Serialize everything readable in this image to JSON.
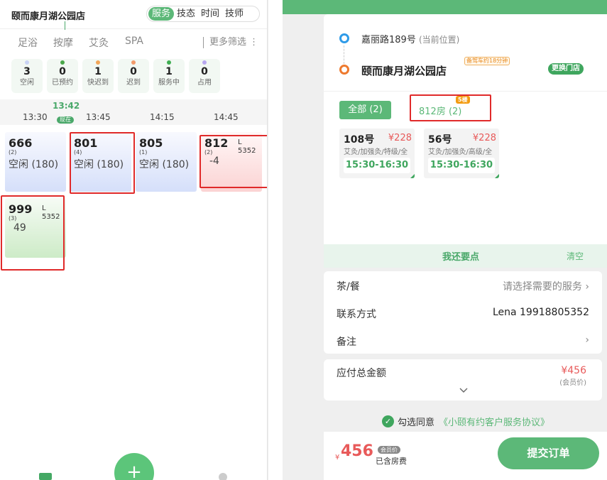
{
  "left": {
    "store_title": "颐而康月湖公园店",
    "segments": [
      "服务",
      "技态",
      "时间",
      "技师"
    ],
    "categories": [
      "足浴",
      "按摩",
      "艾灸",
      "SPA"
    ],
    "more_filter": "更多筛选 ⋮",
    "stats": [
      {
        "num": "3",
        "label": "空闲",
        "color": "#c9d3f5"
      },
      {
        "num": "0",
        "label": "已预约",
        "color": "#4aa84a"
      },
      {
        "num": "1",
        "label": "快迟到",
        "color": "#f2a65a"
      },
      {
        "num": "0",
        "label": "迟到",
        "color": "#f29a6a"
      },
      {
        "num": "1",
        "label": "服务中",
        "color": "#3fae52"
      },
      {
        "num": "0",
        "label": "占用",
        "color": "#b8a8f0"
      }
    ],
    "times": [
      "13:30",
      "13:45",
      "14:15",
      "14:45"
    ],
    "now_time": "13:42",
    "now_badge": "现在",
    "cards": [
      {
        "room": "666",
        "count": "(2)",
        "status": "空闲 (180)"
      },
      {
        "room": "801",
        "count": "(4)",
        "status": "空闲 (180)"
      },
      {
        "room": "805",
        "count": "(1)",
        "status": "空闲 (180)"
      },
      {
        "room": "812",
        "count": "(2)",
        "level": "L",
        "phone": "5352",
        "amount": "-4"
      },
      {
        "room": "999",
        "count": "(3)",
        "level": "L",
        "phone": "5352",
        "amount": "49"
      }
    ],
    "fab": "+"
  },
  "right": {
    "current_address": "嘉丽路189号",
    "current_address_note": "(当前位置)",
    "shop_name": "颐而康月湖公园店",
    "eta_tag": "备驾车约18分钟",
    "change_store": "更换门店",
    "all_button": "全部 (2)",
    "room_tag": "812房 (2)",
    "floor_badge": "5楼",
    "services": [
      {
        "room": "108号",
        "price": "¥228",
        "desc": "艾灸/加强灸/特级/全",
        "time": "15:30-16:30"
      },
      {
        "room": "56号",
        "price": "¥228",
        "desc": "艾灸/加强灸/高级/全",
        "time": "15:30-16:30"
      }
    ],
    "add_more": "我还要点",
    "clear": "清空",
    "tea_label": "茶/餐",
    "tea_value": "请选择需要的服务 ›",
    "contact_label": "联系方式",
    "contact_value": "Lena 19918805352",
    "note_label": "备注",
    "note_value": "›",
    "total_label": "应付总金额",
    "total_price": "¥456",
    "total_member": "(会员价)",
    "agree_text": "勾选同意",
    "agree_link": "《小颐有约客户服务协议》",
    "footer_yen": "¥",
    "footer_amount": "456",
    "footer_badge": "会员价",
    "footer_included": "已含房费",
    "submit": "提交订单"
  }
}
